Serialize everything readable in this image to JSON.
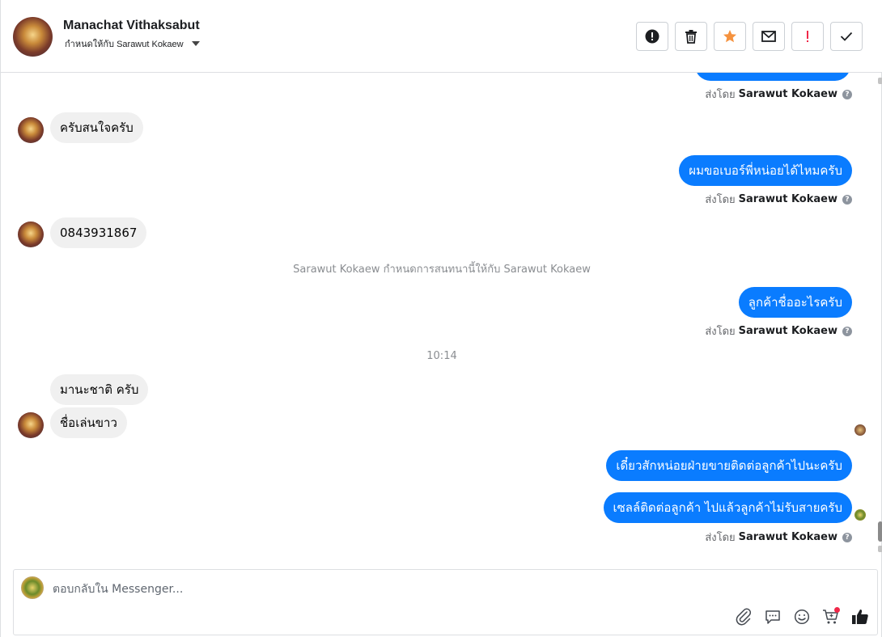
{
  "header": {
    "contact_name": "Manachat Vithaksabut",
    "assigned_to": "กำหนดให้กับ Sarawut Kokaew",
    "actions": [
      {
        "name": "spam-button",
        "icon": "alert-circle-icon"
      },
      {
        "name": "delete-button",
        "icon": "trash-icon"
      },
      {
        "name": "star-button",
        "icon": "star-icon"
      },
      {
        "name": "mark-unread-button",
        "icon": "envelope-icon"
      },
      {
        "name": "follow-up-button",
        "icon": "exclamation-icon"
      },
      {
        "name": "done-button",
        "icon": "check-icon"
      }
    ]
  },
  "colors": {
    "outgoing_bubble": "#0a7cff",
    "incoming_bubble": "#f0f0f0",
    "star": "#f5923e",
    "follow_up": "#f02849"
  },
  "thread": {
    "sent_by_prefix": "ส่งโดย",
    "sent_by_name": "Sarawut Kokaew",
    "messages": [
      {
        "text": "ครับสนใจครับ"
      },
      {
        "text": "ผมขอเบอร์พี่หน่อยได้ไหมครับ"
      },
      {
        "text": "0843931867"
      },
      {
        "text": "ลูกค้าชื่ออะไรครับ"
      },
      {
        "text": "มานะชาติ ครับ"
      },
      {
        "text": "ชื่อเล่นขาว"
      },
      {
        "text": "เดี๋ยวสักหน่อยฝ่ายขายติดต่อลูกค้าไปนะครับ"
      },
      {
        "text": "เซลล์ติดต่อลูกค้า ไปแล้วลูกค้าไม่รับสายครับ"
      }
    ],
    "system_note": "Sarawut Kokaew กำหนดการสนทนานี้ให้กับ Sarawut Kokaew",
    "timestamp": "10:14"
  },
  "composer": {
    "placeholder": "ตอบกลับใน Messenger...",
    "tools": [
      "paperclip-icon",
      "speech-bubble-icon",
      "smiley-icon",
      "cart-icon",
      "thumbs-up-icon"
    ]
  }
}
